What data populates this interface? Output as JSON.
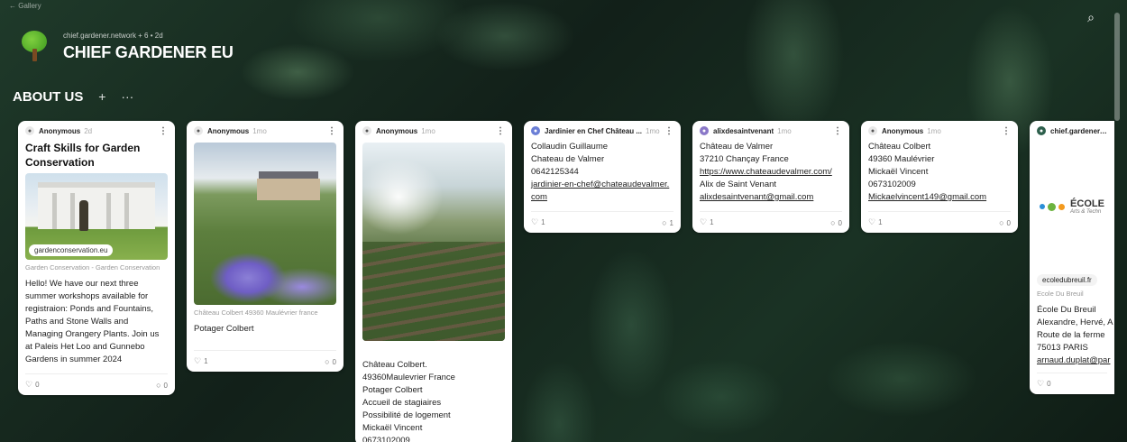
{
  "topbar": {
    "text": "← Gallery"
  },
  "board": {
    "meta": "chief.gardener.network + 6 • 2d",
    "title": "CHIEF GARDENER EU"
  },
  "section": {
    "title": "ABOUT US",
    "add": "+",
    "more": "···"
  },
  "icons": {
    "search": "⌕",
    "like": "♡",
    "comment": "○",
    "menu": "⋮"
  },
  "cards": [
    {
      "author": "Anonymous",
      "age": "2d",
      "title": "Craft Skills for Garden Conservation",
      "link": "gardenconservation.eu",
      "caption": "Garden Conservation - Garden Conservation",
      "body": "Hello! We have our next three summer workshops available for registraion: Ponds and Fountains, Paths and Stone Walls and Managing Orangery Plants. Join us at Paleis Het Loo and Gunnebo Gardens in summer 2024",
      "likes": "0",
      "comments": "0"
    },
    {
      "author": "Anonymous",
      "age": "1mo",
      "caption": "Château Colbert 49360 Maulévrier france",
      "body": "Potager Colbert",
      "likes": "1",
      "comments": "0"
    },
    {
      "author": "Anonymous",
      "age": "1mo",
      "lines": [
        "Château Colbert.",
        "49360Maulevrier France",
        "Potager Colbert",
        "Accueil de stagiaires",
        "Possibilité de logement",
        "Mickaël Vincent",
        "0673102009"
      ]
    },
    {
      "author": "Jardinier en Chef Château ...",
      "age": "1mo",
      "lines": [
        "Collaudin Guillaume",
        "Chateau de Valmer",
        "0642125344"
      ],
      "email": "jardinier-en-chef@chateaudevalmer.com",
      "likes": "1",
      "comments": "1"
    },
    {
      "author": "alixdesaintvenant",
      "age": "1mo",
      "lines": [
        "Château de Valmer",
        "37210 Chançay France"
      ],
      "url": "https://www.chateaudevalmer.com/",
      "name": "Alix de Saint Venant",
      "email": "alixdesaintvenant@gmail.com",
      "likes": "1",
      "comments": "0"
    },
    {
      "author": "Anonymous",
      "age": "1mo",
      "lines": [
        "Château Colbert",
        "49360 Maulévrier",
        "Mickaël Vincent",
        "0673102009"
      ],
      "email": "Mickaelvincent149@gmail.com",
      "likes": "1",
      "comments": "0"
    },
    {
      "author": "chief.gardener.ne",
      "logo_text": "ÉCOLE",
      "logo_sub": "Arts & Techn",
      "link": "ecoledubreuil.fr",
      "caption": "Ecole Du Breuil",
      "lines": [
        "École Du Breuil",
        "Alexandre, Hervé, A",
        "Route de la ferme",
        "75013 PARIS"
      ],
      "email": "arnaud.duplat@par",
      "likes": "0"
    }
  ],
  "colors": {
    "logo_green": "#6cb33f",
    "logo_blue": "#2a8fd8",
    "logo_orange": "#f39a1e"
  }
}
